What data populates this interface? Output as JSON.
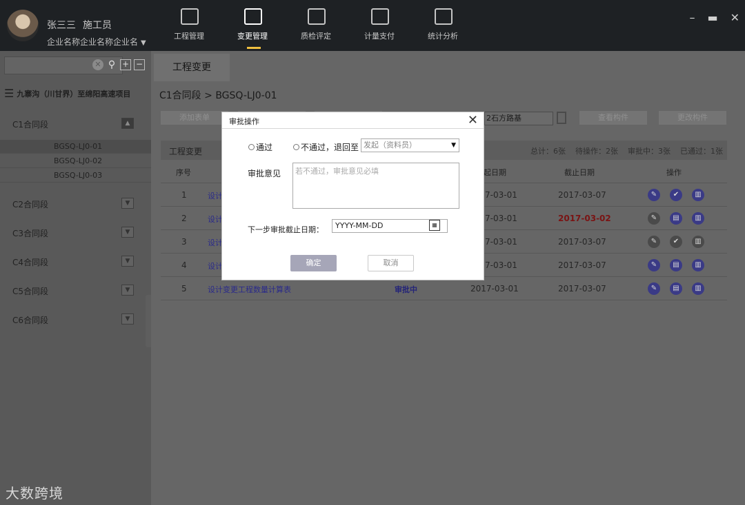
{
  "user": {
    "name": "张三三",
    "role": "施工员",
    "company": "企业名称企业名称企业名"
  },
  "nav": [
    {
      "label": "工程管理",
      "active": false,
      "icon": "list-icon"
    },
    {
      "label": "变更管理",
      "active": true,
      "icon": "shuffle-icon"
    },
    {
      "label": "质检评定",
      "active": false,
      "icon": "monitor-icon"
    },
    {
      "label": "计量支付",
      "active": false,
      "icon": "payment-icon"
    },
    {
      "label": "统计分析",
      "active": false,
      "icon": "chart-icon"
    }
  ],
  "sidebar": {
    "project": "九寨沟（川甘界）至绵阳高速项目",
    "segments": [
      {
        "label": "C1合同段",
        "open": true
      },
      {
        "label": "C2合同段"
      },
      {
        "label": "C3合同段"
      },
      {
        "label": "C4合同段"
      },
      {
        "label": "C5合同段"
      },
      {
        "label": "C6合同段"
      }
    ],
    "subitems": [
      "BGSQ-LJ0-01",
      "BGSQ-LJ0-02",
      "BGSQ-LJ0-03"
    ]
  },
  "tab": "工程变更",
  "breadcrumb": "C1合同段 > BGSQ-LJ0-01",
  "toolbar": {
    "add": "添加表单",
    "filter": "2石方路基",
    "view": "查看构件",
    "change": "更改构件"
  },
  "table": {
    "title": "工程变更",
    "stats": [
      "总计：6张",
      "待操作：2张",
      "审批中：3张",
      "已通过：1张"
    ],
    "columns": {
      "no": "序号",
      "start": "起日期",
      "end": "截止日期",
      "ops": "操作"
    },
    "rows": [
      {
        "no": "1",
        "name": "设计",
        "start": "7-03-01",
        "end": "2017-03-07"
      },
      {
        "no": "2",
        "name": "设计",
        "start": "7-03-01",
        "end": "2017-03-02"
      },
      {
        "no": "3",
        "name": "设计",
        "start": "7-03-01",
        "end": "2017-03-07"
      },
      {
        "no": "4",
        "name": "设计",
        "start": "7-03-01",
        "end": "2017-03-07"
      },
      {
        "no": "5",
        "name": "设计变更工程数量计算表",
        "status": "审批中",
        "start": "2017-03-01",
        "end": "2017-03-07"
      }
    ]
  },
  "dialog": {
    "title": "审批操作",
    "pass": "通过",
    "reject": "不通过，退回至",
    "return_to": "发起（资料员）",
    "opinion_label": "审批意见",
    "opinion_placeholder": "若不通过，审批意见必填",
    "deadline_label": "下一步审批截止日期：",
    "deadline_value": "YYYY-MM-DD",
    "ok": "确定",
    "cancel": "取消"
  },
  "logo": "大数跨境"
}
